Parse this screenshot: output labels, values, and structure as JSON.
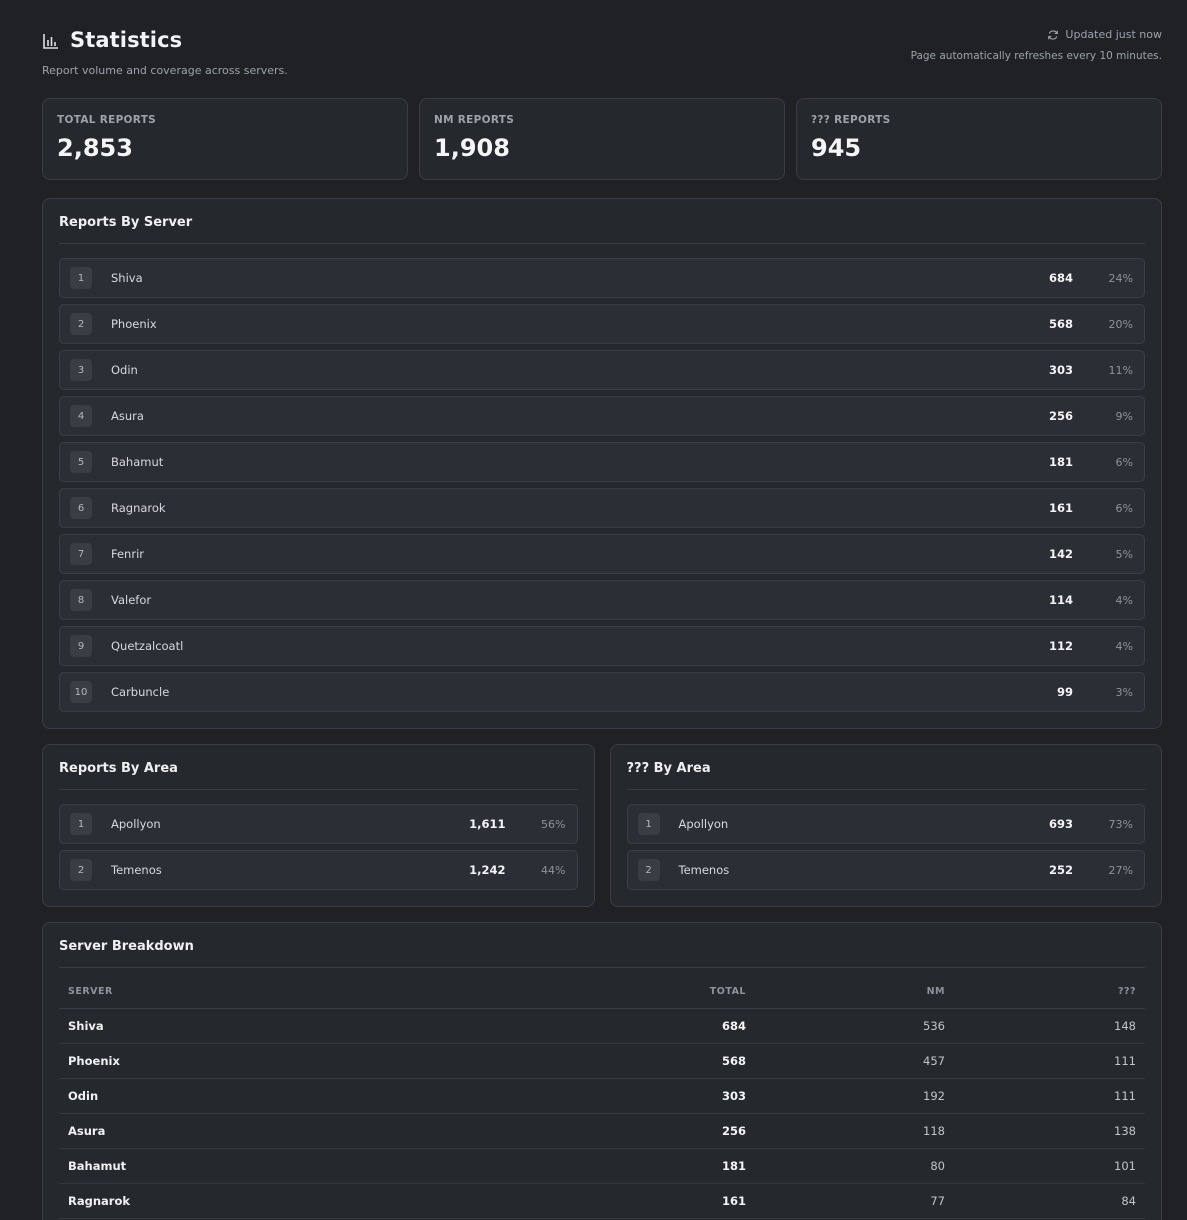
{
  "header": {
    "title": "Statistics",
    "subtitle": "Report volume and coverage across servers.",
    "updated": "Updated just now",
    "refresh_note": "Page automatically refreshes every 10 minutes."
  },
  "cards": [
    {
      "label": "TOTAL REPORTS",
      "value": "2,853"
    },
    {
      "label": "NM REPORTS",
      "value": "1,908"
    },
    {
      "label": "??? REPORTS",
      "value": "945"
    }
  ],
  "by_server": {
    "title": "Reports By Server",
    "rows": [
      {
        "rank": "1",
        "name": "Shiva",
        "count": "684",
        "pct": "24%"
      },
      {
        "rank": "2",
        "name": "Phoenix",
        "count": "568",
        "pct": "20%"
      },
      {
        "rank": "3",
        "name": "Odin",
        "count": "303",
        "pct": "11%"
      },
      {
        "rank": "4",
        "name": "Asura",
        "count": "256",
        "pct": "9%"
      },
      {
        "rank": "5",
        "name": "Bahamut",
        "count": "181",
        "pct": "6%"
      },
      {
        "rank": "6",
        "name": "Ragnarok",
        "count": "161",
        "pct": "6%"
      },
      {
        "rank": "7",
        "name": "Fenrir",
        "count": "142",
        "pct": "5%"
      },
      {
        "rank": "8",
        "name": "Valefor",
        "count": "114",
        "pct": "4%"
      },
      {
        "rank": "9",
        "name": "Quetzalcoatl",
        "count": "112",
        "pct": "4%"
      },
      {
        "rank": "10",
        "name": "Carbuncle",
        "count": "99",
        "pct": "3%"
      }
    ]
  },
  "by_area": {
    "title": "Reports By Area",
    "rows": [
      {
        "rank": "1",
        "name": "Apollyon",
        "count": "1,611",
        "pct": "56%"
      },
      {
        "rank": "2",
        "name": "Temenos",
        "count": "1,242",
        "pct": "44%"
      }
    ]
  },
  "unknown_by_area": {
    "title": "??? By Area",
    "rows": [
      {
        "rank": "1",
        "name": "Apollyon",
        "count": "693",
        "pct": "73%"
      },
      {
        "rank": "2",
        "name": "Temenos",
        "count": "252",
        "pct": "27%"
      }
    ]
  },
  "breakdown": {
    "title": "Server Breakdown",
    "columns": [
      "SERVER",
      "TOTAL",
      "NM",
      "???"
    ],
    "rows": [
      {
        "server": "Shiva",
        "total": "684",
        "nm": "536",
        "unknown": "148"
      },
      {
        "server": "Phoenix",
        "total": "568",
        "nm": "457",
        "unknown": "111"
      },
      {
        "server": "Odin",
        "total": "303",
        "nm": "192",
        "unknown": "111"
      },
      {
        "server": "Asura",
        "total": "256",
        "nm": "118",
        "unknown": "138"
      },
      {
        "server": "Bahamut",
        "total": "181",
        "nm": "80",
        "unknown": "101"
      },
      {
        "server": "Ragnarok",
        "total": "161",
        "nm": "77",
        "unknown": "84"
      }
    ]
  },
  "icons": {
    "title": "bar-chart-icon",
    "refresh": "refresh-icon"
  },
  "colors": {
    "background": "#1f2125",
    "panel": "#25282d",
    "border": "#3a3d43",
    "text": "#e6e7ea",
    "muted": "#9ea2aa"
  }
}
